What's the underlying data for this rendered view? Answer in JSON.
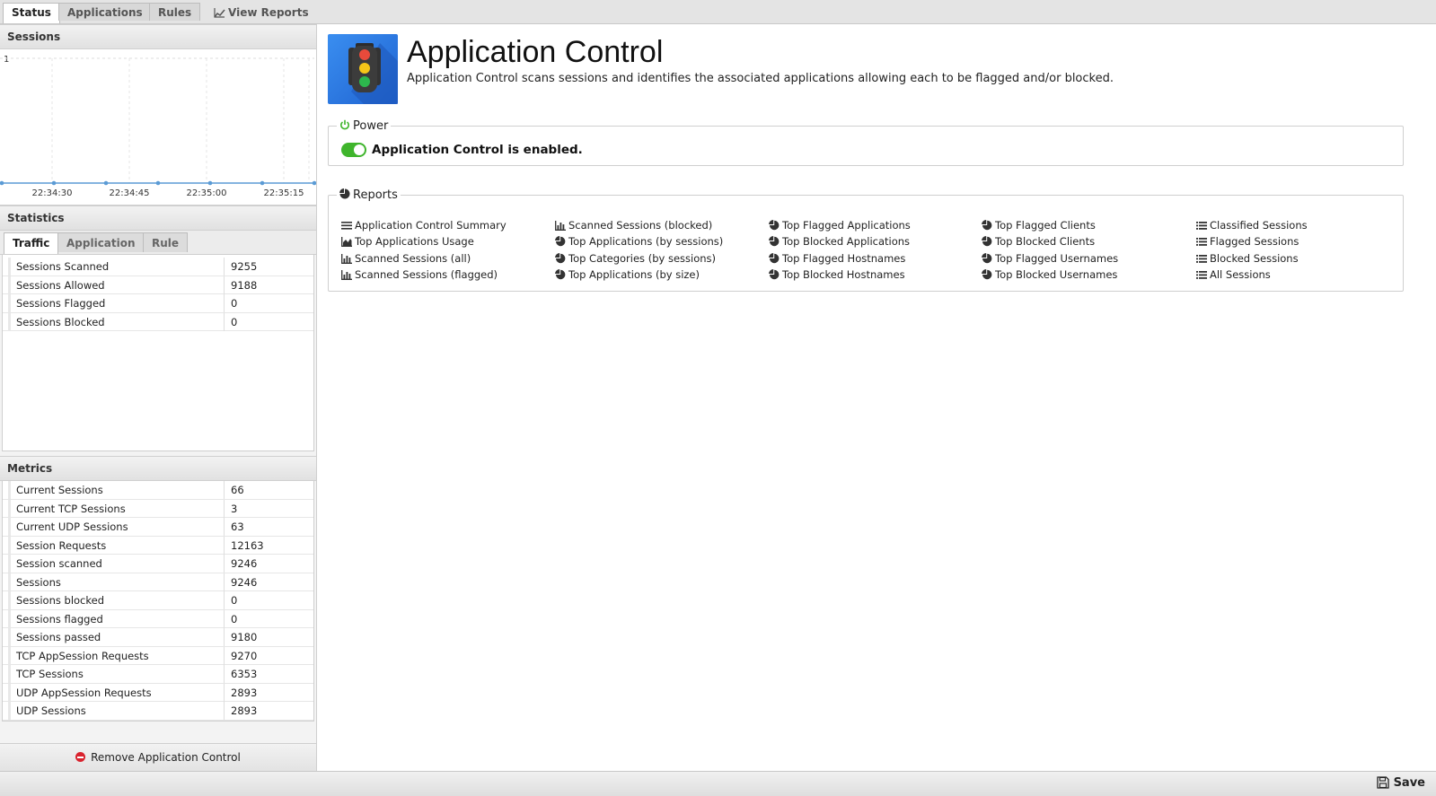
{
  "tabs": [
    {
      "label": "Status"
    },
    {
      "label": "Applications"
    },
    {
      "label": "Rules"
    },
    {
      "label": "View Reports"
    }
  ],
  "sessions_panel": {
    "title": "Sessions",
    "y_top_label": "1",
    "time_labels": [
      "22:34:30",
      "22:34:45",
      "22:35:00",
      "22:35:15"
    ]
  },
  "chart_data": {
    "type": "line",
    "title": "",
    "xlabel": "",
    "ylabel": "",
    "categories": [
      "22:34:30",
      "22:34:45",
      "22:35:00",
      "22:35:15"
    ],
    "ylim": [
      0,
      1
    ],
    "series": [
      {
        "values": [
          0,
          0,
          0,
          0,
          0,
          0,
          0
        ]
      }
    ]
  },
  "statistics": {
    "title": "Statistics",
    "tabs": [
      "Traffic",
      "Application",
      "Rule"
    ],
    "rows": [
      {
        "key": "Sessions Scanned",
        "value": "9255"
      },
      {
        "key": "Sessions Allowed",
        "value": "9188"
      },
      {
        "key": "Sessions Flagged",
        "value": "0"
      },
      {
        "key": "Sessions Blocked",
        "value": "0"
      }
    ]
  },
  "metrics": {
    "title": "Metrics",
    "rows": [
      {
        "key": "Current Sessions",
        "value": "66"
      },
      {
        "key": "Current TCP Sessions",
        "value": "3"
      },
      {
        "key": "Current UDP Sessions",
        "value": "63"
      },
      {
        "key": "Session Requests",
        "value": "12163"
      },
      {
        "key": "Session scanned",
        "value": "9246"
      },
      {
        "key": "Sessions",
        "value": "9246"
      },
      {
        "key": "Sessions blocked",
        "value": "0"
      },
      {
        "key": "Sessions flagged",
        "value": "0"
      },
      {
        "key": "Sessions passed",
        "value": "9180"
      },
      {
        "key": "TCP AppSession Requests",
        "value": "9270"
      },
      {
        "key": "TCP Sessions",
        "value": "6353"
      },
      {
        "key": "UDP AppSession Requests",
        "value": "2893"
      },
      {
        "key": "UDP Sessions",
        "value": "2893"
      }
    ]
  },
  "remove_label": "Remove Application Control",
  "app": {
    "title": "Application Control",
    "description": "Application Control scans sessions and identifies the associated applications allowing each to be flagged and/or blocked.",
    "icon": "traffic-light-icon"
  },
  "power": {
    "legend": "Power",
    "status_text": "Application Control is enabled.",
    "enabled": true,
    "toggle_color": "#3fb52c"
  },
  "reports": {
    "legend": "Reports",
    "columns": [
      [
        {
          "label": "Application Control Summary",
          "icon": "list-icon"
        },
        {
          "label": "Top Applications Usage",
          "icon": "area-chart-icon"
        },
        {
          "label": "Scanned Sessions (all)",
          "icon": "bar-chart-icon"
        },
        {
          "label": "Scanned Sessions (flagged)",
          "icon": "bar-chart-icon"
        }
      ],
      [
        {
          "label": "Scanned Sessions (blocked)",
          "icon": "bar-chart-icon"
        },
        {
          "label": "Top Applications (by sessions)",
          "icon": "pie-chart-icon"
        },
        {
          "label": "Top Categories (by sessions)",
          "icon": "pie-chart-icon"
        },
        {
          "label": "Top Applications (by size)",
          "icon": "pie-chart-icon"
        }
      ],
      [
        {
          "label": "Top Flagged Applications",
          "icon": "pie-chart-icon"
        },
        {
          "label": "Top Blocked Applications",
          "icon": "pie-chart-icon"
        },
        {
          "label": "Top Flagged Hostnames",
          "icon": "pie-chart-icon"
        },
        {
          "label": "Top Blocked Hostnames",
          "icon": "pie-chart-icon"
        }
      ],
      [
        {
          "label": "Top Flagged Clients",
          "icon": "pie-chart-icon"
        },
        {
          "label": "Top Blocked Clients",
          "icon": "pie-chart-icon"
        },
        {
          "label": "Top Flagged Usernames",
          "icon": "pie-chart-icon"
        },
        {
          "label": "Top Blocked Usernames",
          "icon": "pie-chart-icon"
        }
      ],
      [
        {
          "label": "Classified Sessions",
          "icon": "table-list-icon"
        },
        {
          "label": "Flagged Sessions",
          "icon": "table-list-icon"
        },
        {
          "label": "Blocked Sessions",
          "icon": "table-list-icon"
        },
        {
          "label": "All Sessions",
          "icon": "table-list-icon"
        }
      ]
    ]
  },
  "save_label": "Save",
  "colors": {
    "accent_blue": "#2a74e0",
    "enabled_green": "#3fb52c",
    "remove_red": "#d9232e",
    "chart_line": "#5b9bd5"
  }
}
